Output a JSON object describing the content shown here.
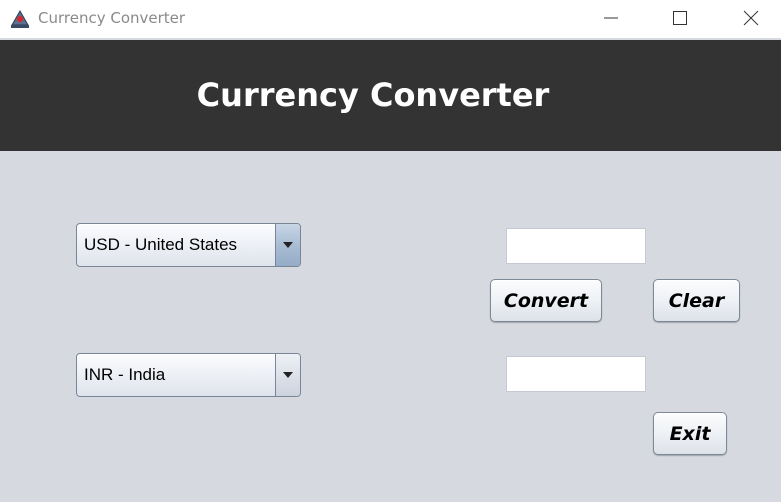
{
  "window": {
    "title": "Currency Converter",
    "icon": "java-coffee-icon",
    "controls": [
      "minimize-icon",
      "maximize-icon",
      "close-icon"
    ]
  },
  "header": {
    "title": "Currency Converter",
    "background": "#333333",
    "color": "#ffffff"
  },
  "from_currency": {
    "selected": "USD - United States"
  },
  "to_currency": {
    "selected": "INR - India"
  },
  "input_amount": {
    "value": "",
    "placeholder": ""
  },
  "output_amount": {
    "value": "",
    "placeholder": ""
  },
  "buttons": {
    "convert": "Convert",
    "clear": "Clear",
    "exit": "Exit"
  },
  "colors": {
    "body_background": "#d6d9e0",
    "field_background": "#ffffff"
  }
}
